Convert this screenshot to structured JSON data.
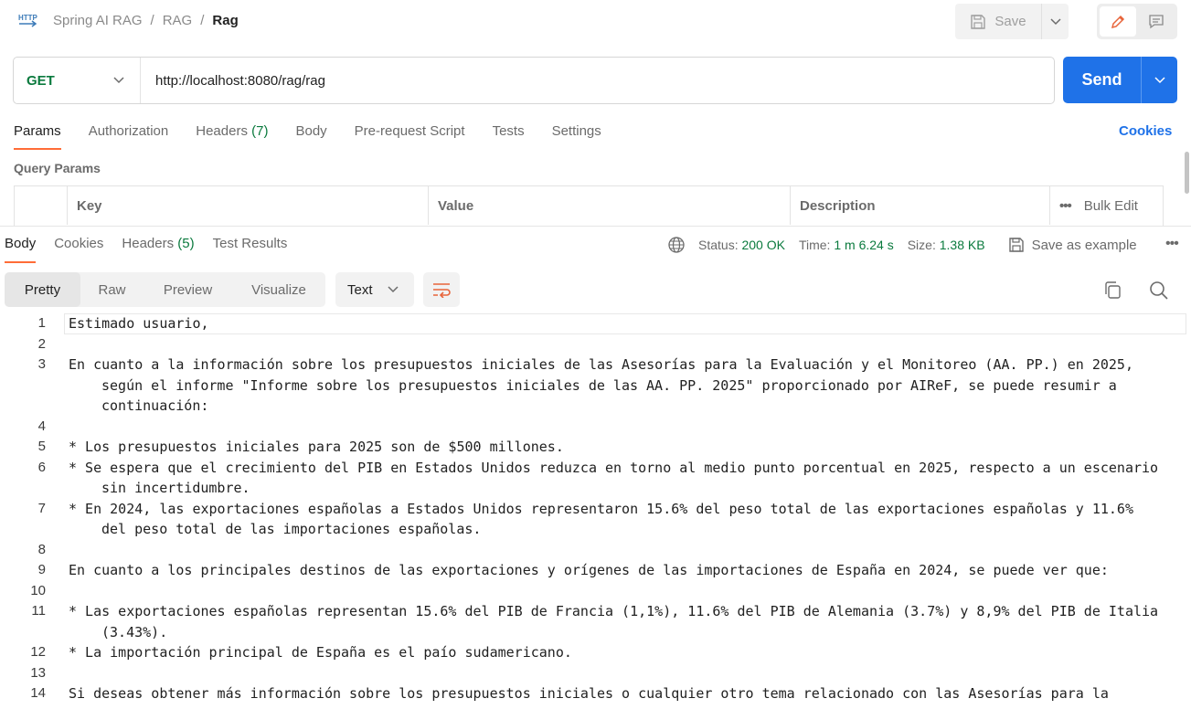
{
  "breadcrumb": {
    "collection": "Spring AI RAG",
    "folder": "RAG",
    "request": "Rag"
  },
  "toolbar": {
    "save_label": "Save"
  },
  "request": {
    "method": "GET",
    "url": "http://localhost:8080/rag/rag",
    "send_label": "Send"
  },
  "req_tabs": {
    "params": "Params",
    "authorization": "Authorization",
    "headers": "Headers",
    "headers_count": "(7)",
    "body": "Body",
    "prerequest": "Pre-request Script",
    "tests": "Tests",
    "settings": "Settings",
    "cookies": "Cookies"
  },
  "query_params": {
    "title": "Query Params",
    "columns": {
      "key": "Key",
      "value": "Value",
      "description": "Description"
    },
    "bulk_edit": "Bulk Edit"
  },
  "response": {
    "tabs": {
      "body": "Body",
      "cookies": "Cookies",
      "headers": "Headers",
      "headers_count": "(5)",
      "test_results": "Test Results"
    },
    "status_label": "Status:",
    "status_value": "200 OK",
    "time_label": "Time:",
    "time_value": "1 m 6.24 s",
    "size_label": "Size:",
    "size_value": "1.38 KB",
    "save_example": "Save as example",
    "views": {
      "pretty": "Pretty",
      "raw": "Raw",
      "preview": "Preview",
      "visualize": "Visualize"
    },
    "format": "Text",
    "lines": [
      {
        "n": "1",
        "text": "Estimado usuario,"
      },
      {
        "n": "2",
        "text": ""
      },
      {
        "n": "3",
        "text": "En cuanto a la información sobre los presupuestos iniciales de las Asesorías para la Evaluación y el Monitoreo (AA. PP.) en 2025, según el informe \"Informe sobre los presupuestos iniciales de las AA. PP. 2025\" proporcionado por AIReF, se puede resumir a continuación:"
      },
      {
        "n": "4",
        "text": ""
      },
      {
        "n": "5",
        "text": "* Los presupuestos iniciales para 2025 son de $500 millones."
      },
      {
        "n": "6",
        "text": "* Se espera que el crecimiento del PIB en Estados Unidos reduzca en torno al medio punto porcentual en 2025, respecto a un escenario sin incertidumbre."
      },
      {
        "n": "7",
        "text": "* En 2024, las exportaciones españolas a Estados Unidos representaron 15.6% del peso total de las exportaciones españolas y 11.6% del peso total de las importaciones españolas."
      },
      {
        "n": "8",
        "text": ""
      },
      {
        "n": "9",
        "text": "En cuanto a los principales destinos de las exportaciones y orígenes de las importaciones de España en 2024, se puede ver que:"
      },
      {
        "n": "10",
        "text": ""
      },
      {
        "n": "11",
        "text": "* Las exportaciones españolas representan 15.6% del PIB de Francia (1,1%), 11.6% del PIB de Alemania (3.7%) y 8,9% del PIB de Italia (3.43%)."
      },
      {
        "n": "12",
        "text": "* La importación principal de España es el paío sudamericano."
      },
      {
        "n": "13",
        "text": ""
      },
      {
        "n": "14",
        "text": "Si deseas obtener más información sobre los presupuestos iniciales o cualquier otro tema relacionado con las Asesorías para la"
      }
    ]
  }
}
